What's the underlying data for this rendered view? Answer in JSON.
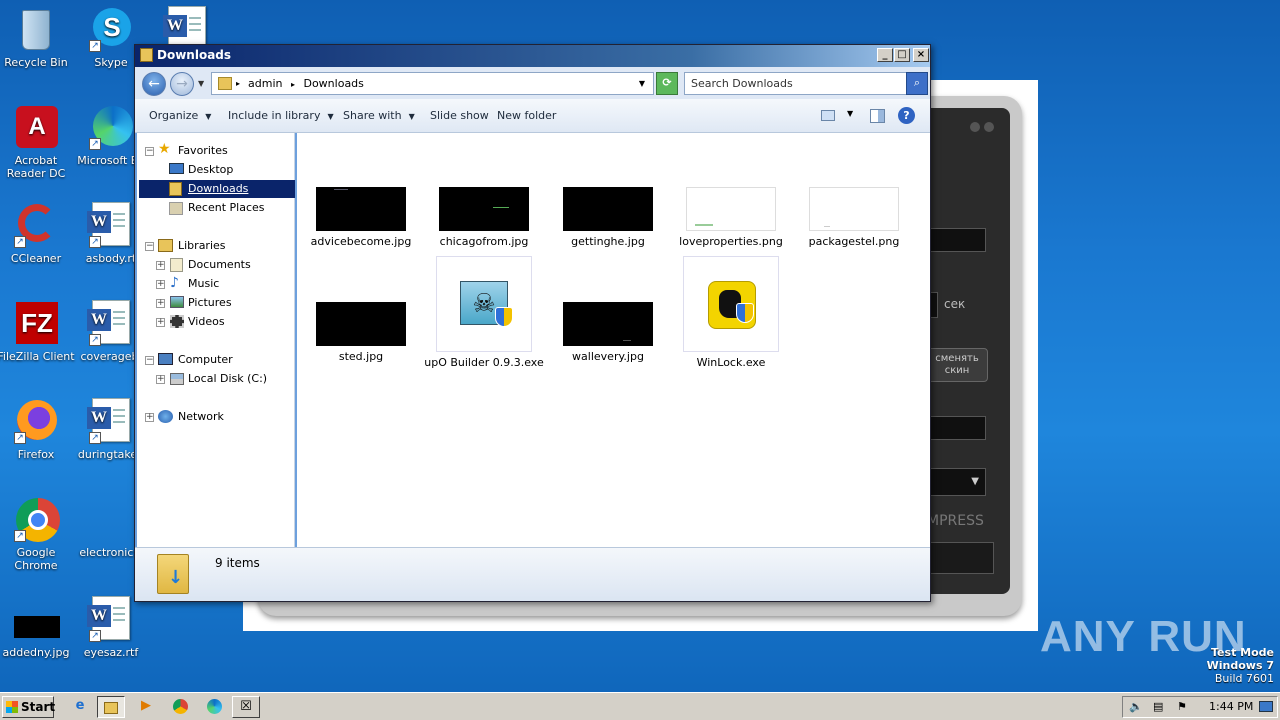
{
  "desktop": {
    "icons": [
      {
        "label": "Recycle Bin",
        "icon": "recycle-bin-icon"
      },
      {
        "label": "Skype",
        "icon": "skype-icon"
      },
      {
        "label": "Acrobat Reader DC",
        "icon": "acrobat-icon"
      },
      {
        "label": "Microsoft Ed",
        "icon": "edge-icon"
      },
      {
        "label": "CCleaner",
        "icon": "ccleaner-icon"
      },
      {
        "label": "asbody.rt",
        "icon": "word-doc-icon"
      },
      {
        "label": "FileZilla Client",
        "icon": "filezilla-icon"
      },
      {
        "label": "coveragebi",
        "icon": "word-doc-icon"
      },
      {
        "label": "Firefox",
        "icon": "firefox-icon"
      },
      {
        "label": "duringtaken",
        "icon": "word-doc-icon"
      },
      {
        "label": "Google Chrome",
        "icon": "chrome-icon"
      },
      {
        "label": "electronics.",
        "icon": "file-icon"
      },
      {
        "label": "addedny.jpg",
        "icon": "image-thumb-icon"
      },
      {
        "label": "eyesaz.rtf",
        "icon": "word-doc-icon"
      }
    ]
  },
  "background_app": {
    "unit_label": "сек",
    "button_label": "сменять скин",
    "mode_label": "MPRESS"
  },
  "window": {
    "title": "Downloads",
    "minimize": "_",
    "maximize": "□",
    "close": "×",
    "address": {
      "segments": [
        "admin",
        "Downloads"
      ]
    },
    "search_placeholder": "Search Downloads",
    "toolbar": {
      "organize": "Organize",
      "include_in_library": "Include in library",
      "share_with": "Share with",
      "slide_show": "Slide show",
      "new_folder": "New folder"
    },
    "nav": {
      "favorites": "Favorites",
      "desktop": "Desktop",
      "downloads": "Downloads",
      "recent_places": "Recent Places",
      "libraries": "Libraries",
      "documents": "Documents",
      "music": "Music",
      "pictures": "Pictures",
      "videos": "Videos",
      "computer": "Computer",
      "local_disk": "Local Disk (C:)",
      "network": "Network"
    },
    "files": [
      {
        "name": "advicebecome.jpg",
        "thumb": "dark"
      },
      {
        "name": "chicagofrom.jpg",
        "thumb": "dark"
      },
      {
        "name": "gettinghe.jpg",
        "thumb": "dark"
      },
      {
        "name": "loveproperties.png",
        "thumb": "light"
      },
      {
        "name": "packagestel.png",
        "thumb": "light"
      },
      {
        "name": "sted.jpg",
        "thumb": "dark"
      },
      {
        "name": "upO Builder 0.9.3.exe",
        "thumb": "exe-skull"
      },
      {
        "name": "wallevery.jpg",
        "thumb": "dark"
      },
      {
        "name": "WinLock.exe",
        "thumb": "exe-winlock"
      }
    ],
    "status": {
      "count": "9 items"
    }
  },
  "taskbar": {
    "start": "Start",
    "clock": "1:44 PM"
  },
  "watermark": {
    "line1": "Test Mode",
    "line2": "Windows 7",
    "line3": "Build 7601",
    "brand": "ANY RUN"
  },
  "colors": {
    "desktop_blue": "#1a78d0",
    "title_bar": "#0a246a",
    "selection": "#0a246a"
  }
}
